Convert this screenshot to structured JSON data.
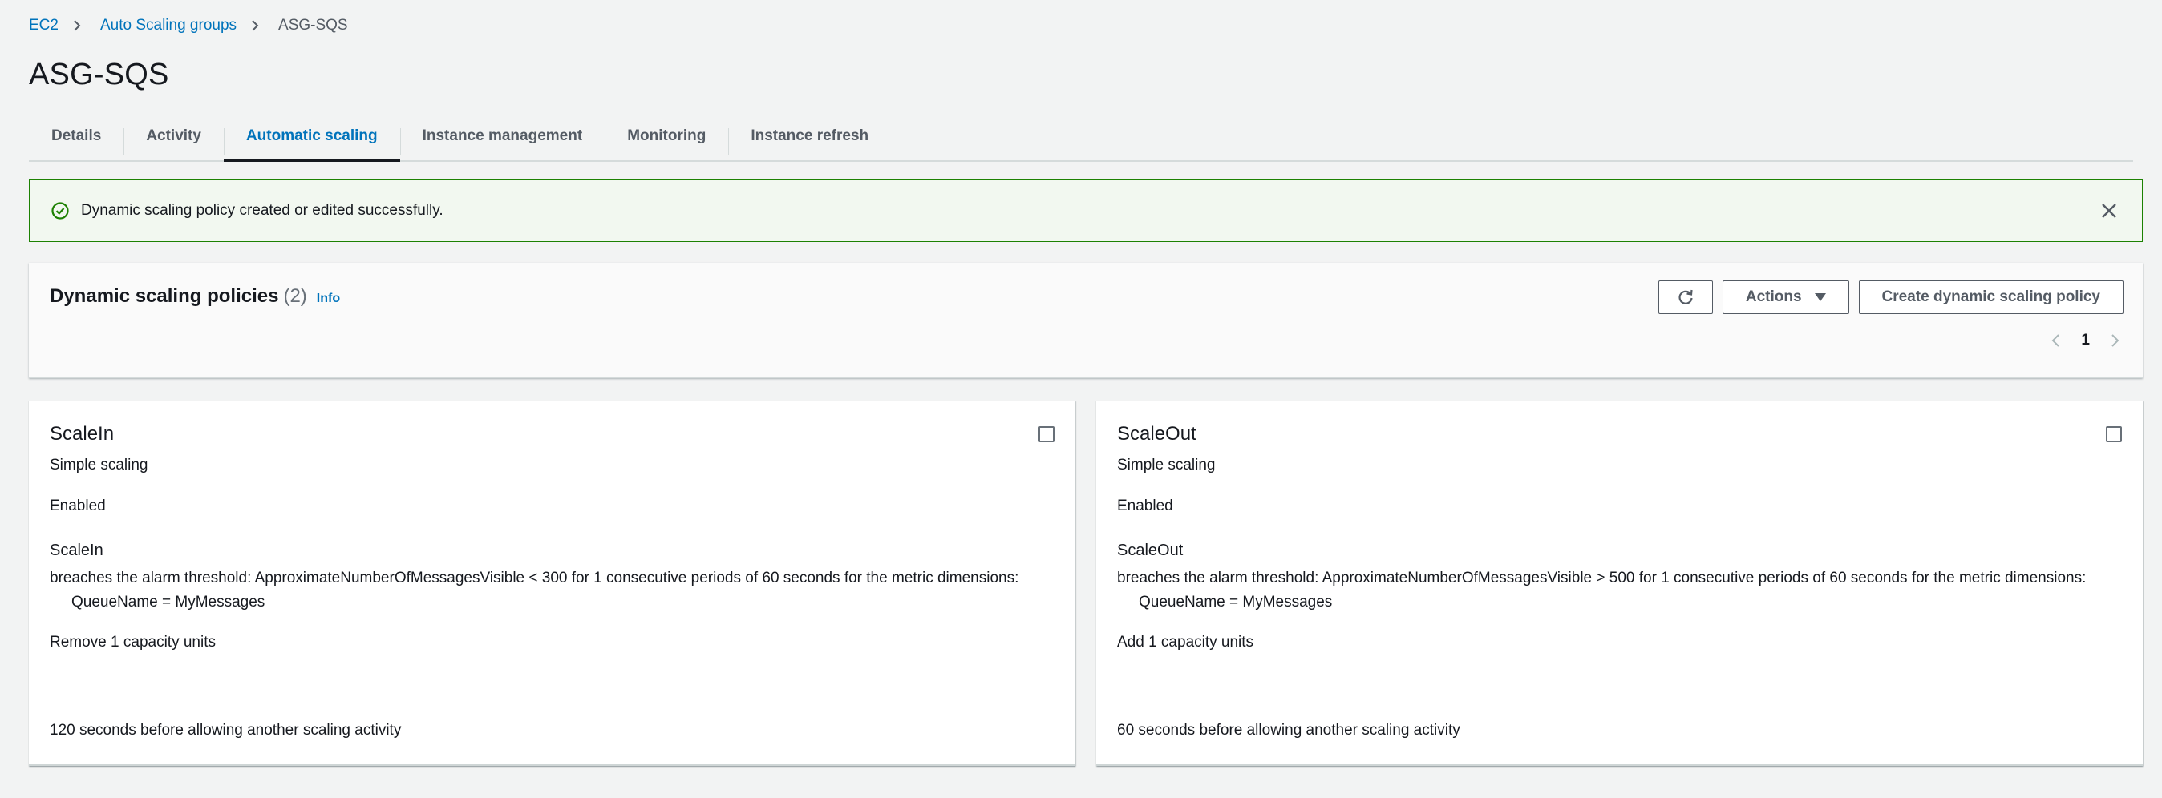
{
  "breadcrumb": {
    "items": [
      "EC2",
      "Auto Scaling groups"
    ],
    "current": "ASG-SQS"
  },
  "title": "ASG-SQS",
  "tabs": [
    {
      "label": "Details"
    },
    {
      "label": "Activity"
    },
    {
      "label": "Automatic scaling",
      "active": true
    },
    {
      "label": "Instance management"
    },
    {
      "label": "Monitoring"
    },
    {
      "label": "Instance refresh"
    }
  ],
  "flash": {
    "message": "Dynamic scaling policy created or edited successfully.",
    "status_color": "#1d8102"
  },
  "policies": {
    "title": "Dynamic scaling policies",
    "count": "(2)",
    "info": "Info",
    "actions_label": "Actions",
    "create_label": "Create dynamic scaling policy",
    "page": "1"
  },
  "cards": [
    {
      "name": "ScaleIn",
      "type": "Simple scaling",
      "status": "Enabled",
      "alarm_name": "ScaleIn",
      "alarm_desc": "breaches the alarm threshold: ApproximateNumberOfMessagesVisible < 300 for 1 consecutive periods of 60 seconds for the metric dimensions:",
      "dimension": "QueueName = MyMessages",
      "action": "Remove 1 capacity units",
      "cooldown": "120 seconds before allowing another scaling activity"
    },
    {
      "name": "ScaleOut",
      "type": "Simple scaling",
      "status": "Enabled",
      "alarm_name": "ScaleOut",
      "alarm_desc": "breaches the alarm threshold: ApproximateNumberOfMessagesVisible > 500 for 1 consecutive periods of 60 seconds for the metric dimensions:",
      "dimension": "QueueName = MyMessages",
      "action": "Add 1 capacity units",
      "cooldown": "60 seconds before allowing another scaling activity"
    }
  ],
  "colors": {
    "link": "#0073bb",
    "text": "#16191f",
    "muted": "#545b64",
    "background": "#f2f3f3"
  }
}
